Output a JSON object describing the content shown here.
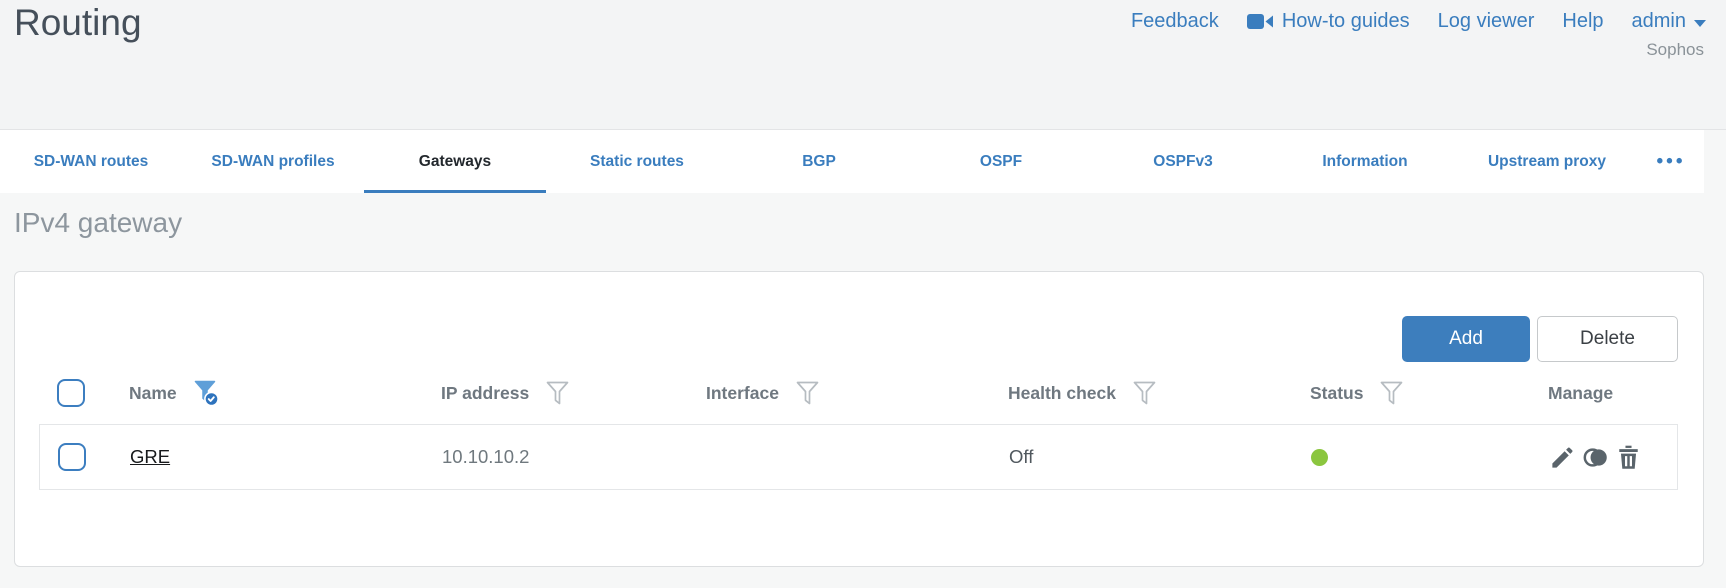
{
  "header": {
    "page_title": "Routing",
    "nav": {
      "feedback": "Feedback",
      "howto_guides": "How-to guides",
      "log_viewer": "Log viewer",
      "help": "Help",
      "user": "admin",
      "brand": "Sophos"
    }
  },
  "tabs": {
    "items": [
      "SD-WAN routes",
      "SD-WAN profiles",
      "Gateways",
      "Static routes",
      "BGP",
      "OSPF",
      "OSPFv3",
      "Information",
      "Upstream proxy"
    ],
    "active": "Gateways",
    "more_label": "•••"
  },
  "main": {
    "section_title": "IPv4 gateway",
    "toolbar": {
      "add_label": "Add",
      "delete_label": "Delete"
    },
    "table": {
      "columns": [
        {
          "label": "Name",
          "filter": "active"
        },
        {
          "label": "IP address",
          "filter": "default"
        },
        {
          "label": "Interface",
          "filter": "default"
        },
        {
          "label": "Health check",
          "filter": "default"
        },
        {
          "label": "Status",
          "filter": "default"
        },
        {
          "label": "Manage",
          "filter": "none"
        }
      ],
      "rows": [
        {
          "name": "GRE",
          "ip": "10.10.10.2",
          "interface": "",
          "health_check": "Off",
          "status": "up",
          "status_dot_style": "background:#8bc63f"
        }
      ]
    }
  },
  "colors": {
    "accent_blue": "#3a7dbe",
    "button_blue": "#3d7ebd",
    "status_green": "#8bc63f"
  }
}
